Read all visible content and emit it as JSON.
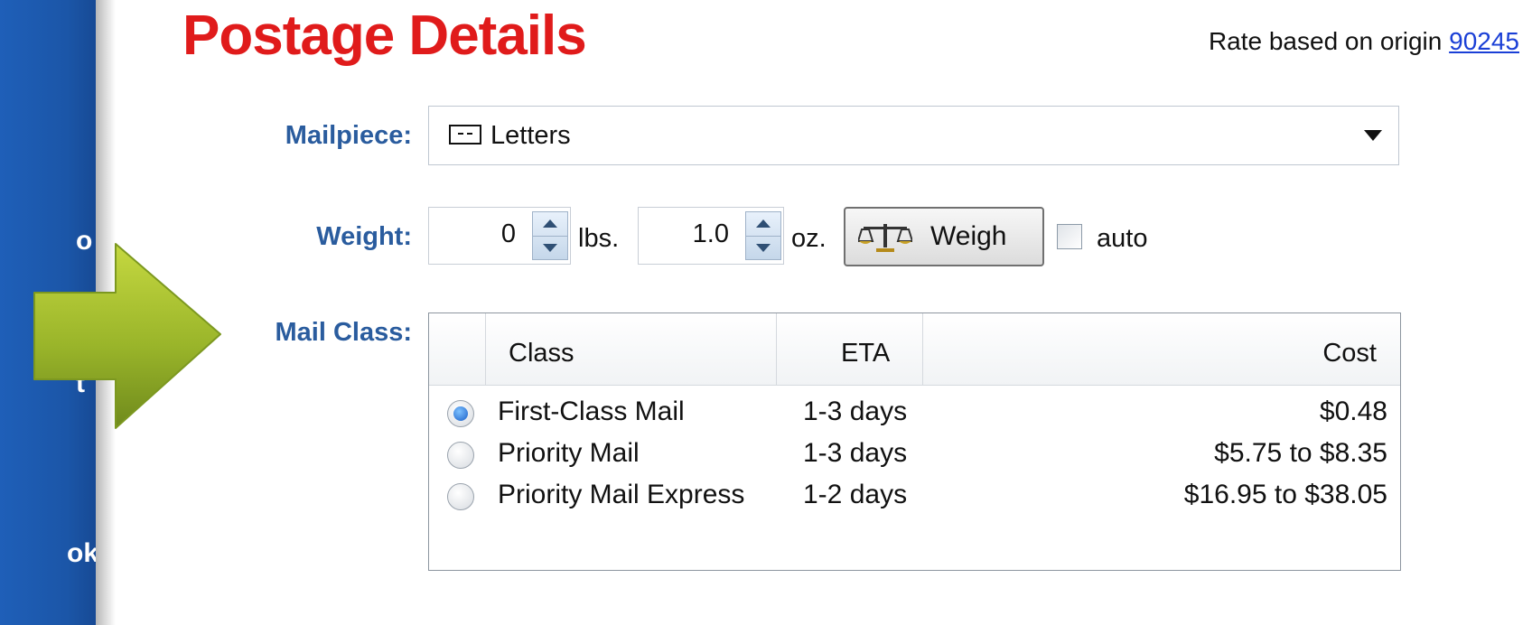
{
  "sidebar": {
    "fragments": [
      "o",
      "t",
      "ok"
    ]
  },
  "header": {
    "title": "Postage Details",
    "origin_text": "Rate based on origin",
    "origin_zip": "90245"
  },
  "form": {
    "mailpiece_label": "Mailpiece:",
    "mailpiece_value": "Letters",
    "weight_label": "Weight:",
    "lbs_value": "0",
    "lbs_unit": "lbs.",
    "oz_value": "1.0",
    "oz_unit": "oz.",
    "weigh_button": "Weigh",
    "auto_label": "auto",
    "auto_checked": false,
    "mail_class_label": "Mail Class:"
  },
  "mail_class_table": {
    "columns": [
      "Class",
      "ETA",
      "Cost"
    ],
    "rows": [
      {
        "class": "First-Class Mail",
        "eta": "1-3 days",
        "cost": "$0.48",
        "selected": true
      },
      {
        "class": "Priority Mail",
        "eta": "1-3 days",
        "cost": "$5.75 to $8.35",
        "selected": false
      },
      {
        "class": "Priority Mail Express",
        "eta": "1-2 days",
        "cost": "$16.95 to $38.05",
        "selected": false
      }
    ]
  },
  "colors": {
    "title": "#e01b1b",
    "label": "#2a5c9e",
    "sidebar": "#1b56a8",
    "link": "#1a3fd6",
    "arrow": "#9ab52a"
  }
}
